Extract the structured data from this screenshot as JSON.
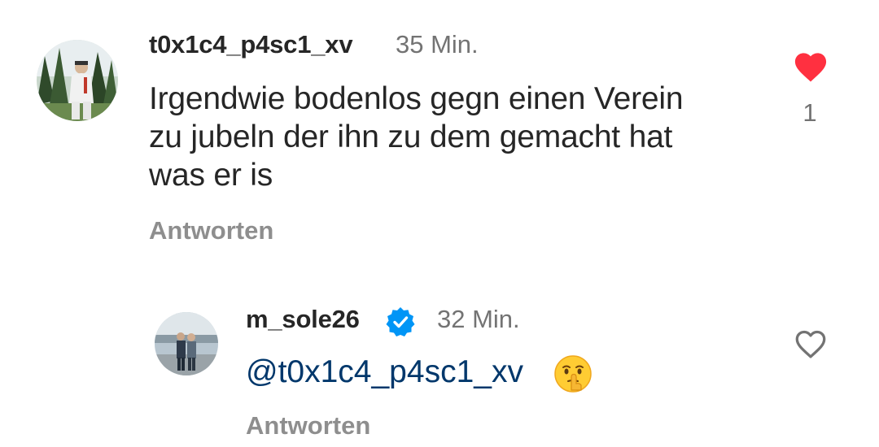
{
  "comments": [
    {
      "username": "t0x1c4_p4sc1_xv",
      "time": "35 Min.",
      "text_lines": [
        "Irgendwie bodenlos gegn einen Verein",
        "zu jubeln der ihn zu dem gemacht hat",
        "was er is"
      ],
      "reply_label": "Antworten",
      "liked": true,
      "like_count": "1",
      "avatar_icon": "profile-photo-person-in-white-tracksuit-forest"
    },
    {
      "username": "m_sole26",
      "verified": true,
      "time": "32 Min.",
      "mention": "@t0x1c4_p4sc1_xv",
      "emoji_name": "shushing-face-emoji",
      "reply_label": "Antworten",
      "liked": false,
      "avatar_icon": "profile-photo-couple-at-sea"
    }
  ],
  "colors": {
    "text": "#262626",
    "secondary": "#737373",
    "reply": "#8e8e8e",
    "mention": "#00376b",
    "like_red": "#ff3040",
    "verified_blue": "#0095f6"
  }
}
